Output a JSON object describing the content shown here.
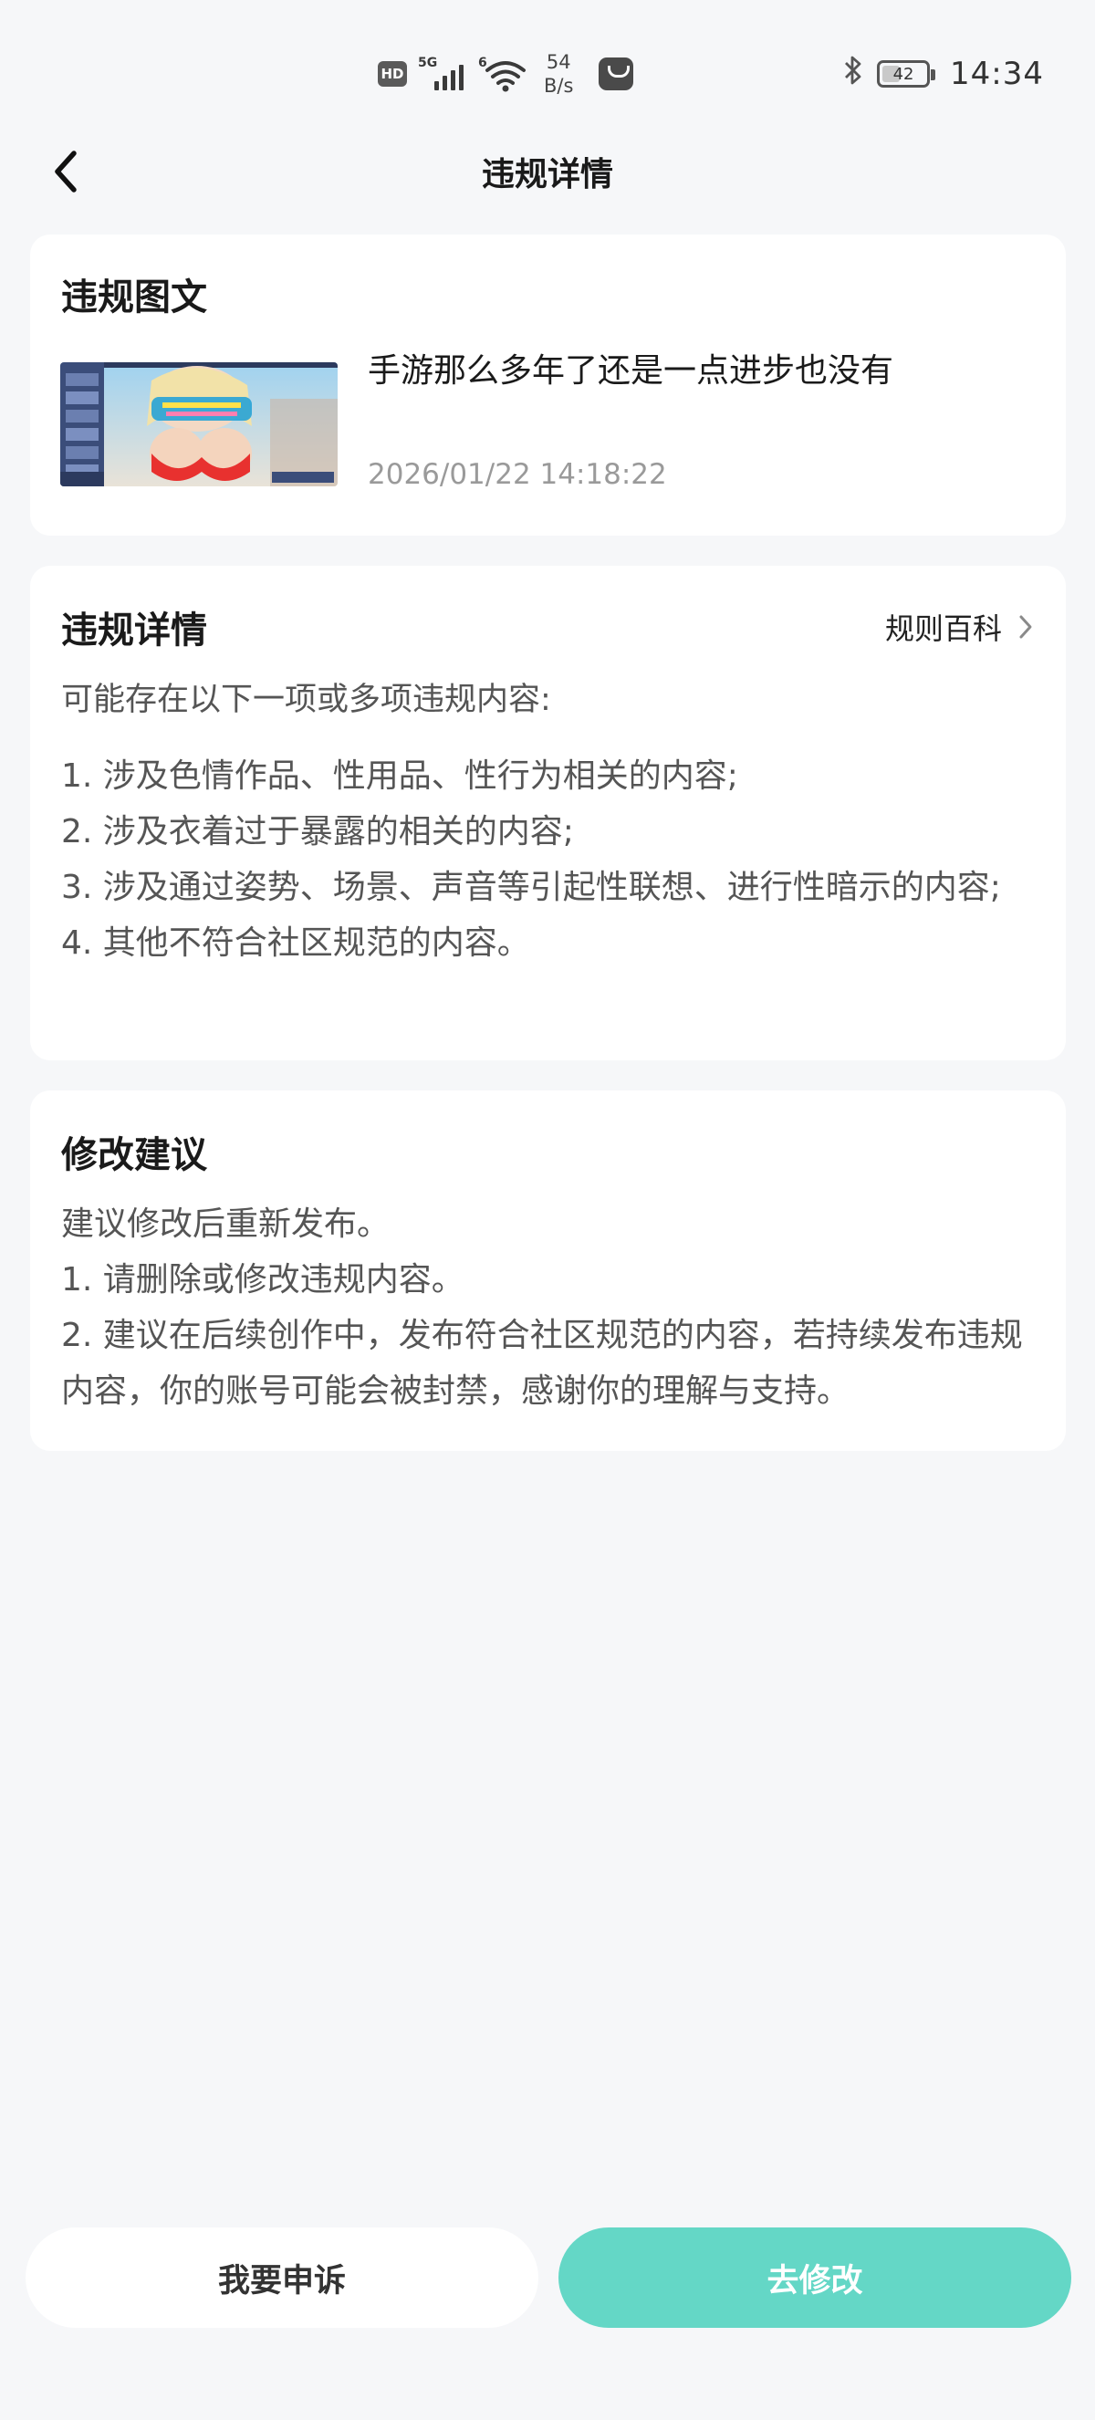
{
  "status_bar": {
    "hd": "HD",
    "network_type": "5G",
    "wifi_tag": "6",
    "speed_value": "54",
    "speed_unit": "B/s",
    "battery_level": "42",
    "battery_fraction": 0.42,
    "time": "14:34",
    "icons": [
      "hd-icon",
      "cellular-signal-icon",
      "wifi-icon",
      "notification-bag-icon",
      "bluetooth-icon",
      "battery-icon"
    ]
  },
  "header": {
    "title": "违规详情",
    "back_icon": "chevron-left-icon"
  },
  "violation_post": {
    "section_title": "违规图文",
    "post_title": "手游那么多年了还是一点进步也没有",
    "post_time": "2026/01/22 14:18:22"
  },
  "violation_details": {
    "section_title": "违规详情",
    "rule_link_label": "规则百科",
    "intro": "可能存在以下一项或多项违规内容:",
    "items": [
      "1. 涉及色情作品、性用品、性行为相关的内容;",
      "2. 涉及衣着过于暴露的相关的内容;",
      "3. 涉及通过姿势、场景、声音等引起性联想、进行性暗示的内容;",
      "4. 其他不符合社区规范的内容。"
    ]
  },
  "suggestions": {
    "section_title": "修改建议",
    "lines": [
      "建议修改后重新发布。",
      "1. 请删除或修改违规内容。",
      "2. 建议在后续创作中，发布符合社区规范的内容，若持续发布违规内容，你的账号可能会被封禁，感谢你的理解与支持。"
    ]
  },
  "actions": {
    "appeal_label": "我要申诉",
    "edit_label": "去修改"
  },
  "colors": {
    "background": "#f6f7f9",
    "card": "#ffffff",
    "accent": "#64d7c6",
    "secondary_text": "#9a9a9a"
  }
}
